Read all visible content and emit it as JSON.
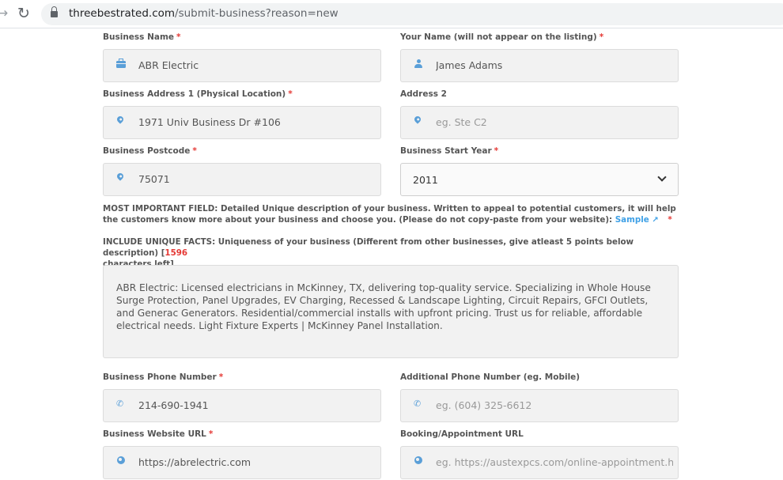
{
  "browser": {
    "url_host": "threebestrated.com",
    "url_path": "/submit-business?reason=new"
  },
  "form": {
    "business_name": {
      "label": "Business Name",
      "value": "ABR Electric",
      "icon": "briefcase-icon"
    },
    "your_name": {
      "label": "Your Name (will not appear on the listing)",
      "value": "James Adams",
      "icon": "user-icon"
    },
    "address1": {
      "label": "Business Address 1 (Physical Location)",
      "value": "1971 Univ Business Dr #106",
      "icon": "location-pin-icon"
    },
    "address2": {
      "label": "Address 2",
      "placeholder": "eg. Ste C2",
      "icon": "location-pin-icon"
    },
    "postcode": {
      "label": "Business Postcode",
      "value": "75071",
      "icon": "location-pin-icon"
    },
    "start_year": {
      "label": "Business Start Year",
      "value": "2011"
    },
    "important_note": "MOST IMPORTANT FIELD: Detailed Unique description of your business. Written to appeal to potential customers, it will help the customers know more about your business and choose you. (Please do not copy-paste from your website):",
    "sample_link": "Sample",
    "unique_facts_prefix": "INCLUDE UNIQUE FACTS: Uniqueness of your business (Different from other businesses, give atleast 5 points below description) [",
    "chars_left_count": "1596",
    "unique_facts_suffix": "characters left]",
    "description": "ABR Electric: Licensed electricians in McKinney, TX, delivering top-quality service. Specializing in Whole House Surge Protection, Panel Upgrades, EV Charging, Recessed & Landscape Lighting, Circuit Repairs, GFCI Outlets, and Generac Generators. Residential/commercial installs with upfront pricing. Trust us for reliable, affordable electrical needs. Light Fixture Experts | McKinney Panel Installation.",
    "phone": {
      "label": "Business Phone Number",
      "value": "214-690-1941",
      "icon": "phone-icon"
    },
    "additional_phone": {
      "label": "Additional Phone Number (eg. Mobile)",
      "placeholder": "eg. (604) 325-6612",
      "icon": "phone-icon"
    },
    "website": {
      "label": "Business Website URL",
      "value": "https://abrelectric.com",
      "icon": "globe-icon"
    },
    "booking": {
      "label": "Booking/Appointment URL",
      "placeholder": "eg. https://austexpcs.com/online-appointment.html",
      "icon": "globe-icon"
    },
    "required_mark": "*"
  },
  "colors": {
    "accent": "#5a9fd8",
    "required": "#e53935",
    "link": "#3ea0e6"
  }
}
